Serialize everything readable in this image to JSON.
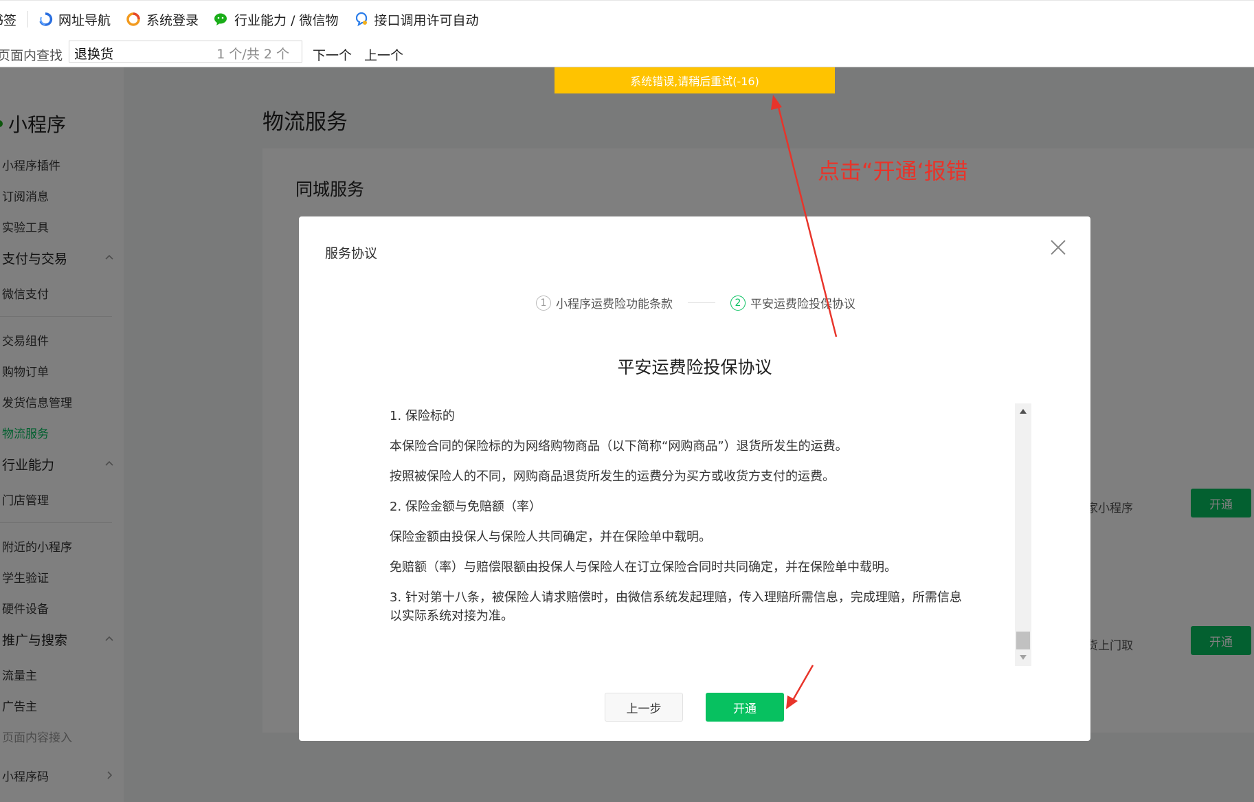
{
  "bookmarks": {
    "items": [
      {
        "label": "书签",
        "icon": "bookmark-icon"
      },
      {
        "label": "网址导航",
        "icon": "nav-logo-icon"
      },
      {
        "label": "系统登录",
        "icon": "login-logo-icon"
      },
      {
        "label": "行业能力 / 微信物",
        "icon": "wechat-icon"
      },
      {
        "label": "接口调用许可自动",
        "icon": "api-logo-icon"
      }
    ]
  },
  "findbar": {
    "label": "页面内查找",
    "query": "退换货",
    "count": "1 个/共 2 个",
    "next_label": "下一个",
    "prev_label": "上一个"
  },
  "sidebar": {
    "brand": "小程序",
    "items": [
      {
        "label": "小程序插件"
      },
      {
        "label": "订阅消息"
      },
      {
        "label": "实验工具"
      },
      {
        "label": "支付与交易"
      },
      {
        "label": "微信支付"
      },
      {
        "label": "交易组件"
      },
      {
        "label": "购物订单"
      },
      {
        "label": "发货信息管理"
      },
      {
        "label": "物流服务"
      },
      {
        "label": "行业能力"
      },
      {
        "label": "门店管理"
      },
      {
        "label": "附近的小程序"
      },
      {
        "label": "学生验证"
      },
      {
        "label": "硬件设备"
      },
      {
        "label": "推广与搜索"
      },
      {
        "label": "流量主"
      },
      {
        "label": "广告主"
      },
      {
        "label": "页面内容接入"
      },
      {
        "label": "小程序码"
      }
    ]
  },
  "main": {
    "title": "物流服务",
    "card_title": "同城服务",
    "services": [
      {
        "desc": "家小程序",
        "button": "开通"
      },
      {
        "desc": "货上门取",
        "button": "开通"
      }
    ]
  },
  "toast": {
    "message": "系统错误,请稍后重试(-16)",
    "color": "#ffc300"
  },
  "modal": {
    "title": "服务协议",
    "steps": [
      {
        "num": "1",
        "label": "小程序运费险功能条款"
      },
      {
        "num": "2",
        "label": "平安运费险投保协议"
      }
    ],
    "doc_title": "平安运费险投保协议",
    "doc_paragraphs": [
      "1. 保险标的",
      "本保险合同的保险标的为网络购物商品（以下简称“网购商品”）退货所发生的运费。",
      "按照被保险人的不同，网购商品退货所发生的运费分为买方或收货方支付的运费。",
      "2. 保险金额与免赔额（率）",
      "保险金额由投保人与保险人共同确定，并在保险单中载明。",
      "免赔额（率）与赔偿限额由投保人与保险人在订立保险合同时共同确定，并在保险单中载明。",
      "3. 针对第十八条，被保险人请求赔偿时，由微信系统发起理赔，传入理赔所需信息，完成理赔，所需信息以实际系统对接为准。"
    ],
    "prev_button": "上一步",
    "open_button": "开通",
    "accent": "#07c160"
  },
  "annotation": {
    "text": "点击“开通‘报错",
    "color": "#e8342a"
  }
}
